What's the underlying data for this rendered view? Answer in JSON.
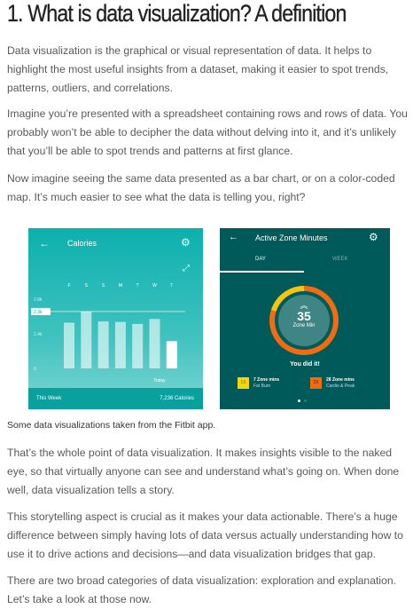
{
  "title": "1. What is data visualization? A definition",
  "paragraphs": [
    "Data visualization is the graphical or visual representation of data. It helps to highlight the most useful insights from a dataset, making it easier to spot trends, patterns, outliers, and correlations.",
    "Imagine you’re presented with a spreadsheet containing rows and rows of data. You probably won’t be able to decipher the data without delving into it, and it’s unlikely that you’ll be able to spot trends and patterns at first glance.",
    "Now imagine seeing the same data presented as a bar chart, or on a color-coded map. It’s much easier to see what the data is telling you, right?",
    "That’s the whole point of data visualization. It makes insights visible to the naked eye, so that virtually anyone can see and understand what’s going on. When done well, data visualization tells a story.",
    "This storytelling aspect is crucial as it makes your data actionable. There’s a huge difference between simply having lots of data versus actually understanding how to use it to drive actions and decisions—and data visualization bridges that gap.",
    "There are two broad categories of data visualization: exploration and explanation. Let’s take a look at those now."
  ],
  "caption": "Some data visualizations taken from the Fitbit app.",
  "calories": {
    "title": "Calories",
    "days": [
      "F",
      "S",
      "S",
      "M",
      "T",
      "W",
      "T"
    ],
    "values": [
      1.85,
      2.3,
      1.9,
      1.88,
      1.8,
      2.0,
      1.1
    ],
    "ticks": [
      "2.8k",
      "2.3k",
      "1.4k",
      "0"
    ],
    "today": "Today",
    "footer_left": "This Week",
    "footer_right": "7,236 Calories",
    "bg": "#0cb0ad"
  },
  "azm": {
    "title": "Active Zone Minutes",
    "tabs": [
      "DAY",
      "WEEK"
    ],
    "value": "35",
    "unit": "Zone Min",
    "message": "You did it!",
    "legend": [
      {
        "badge": "1X",
        "line1": "7 Zone mins",
        "line2": "Fat Burn",
        "color": "#f5d410"
      },
      {
        "badge": "2X",
        "line1": "28 Zone mins",
        "line2": "Cardio & Peak",
        "color": "#f26b0f"
      }
    ],
    "bg": "#005a5a"
  }
}
